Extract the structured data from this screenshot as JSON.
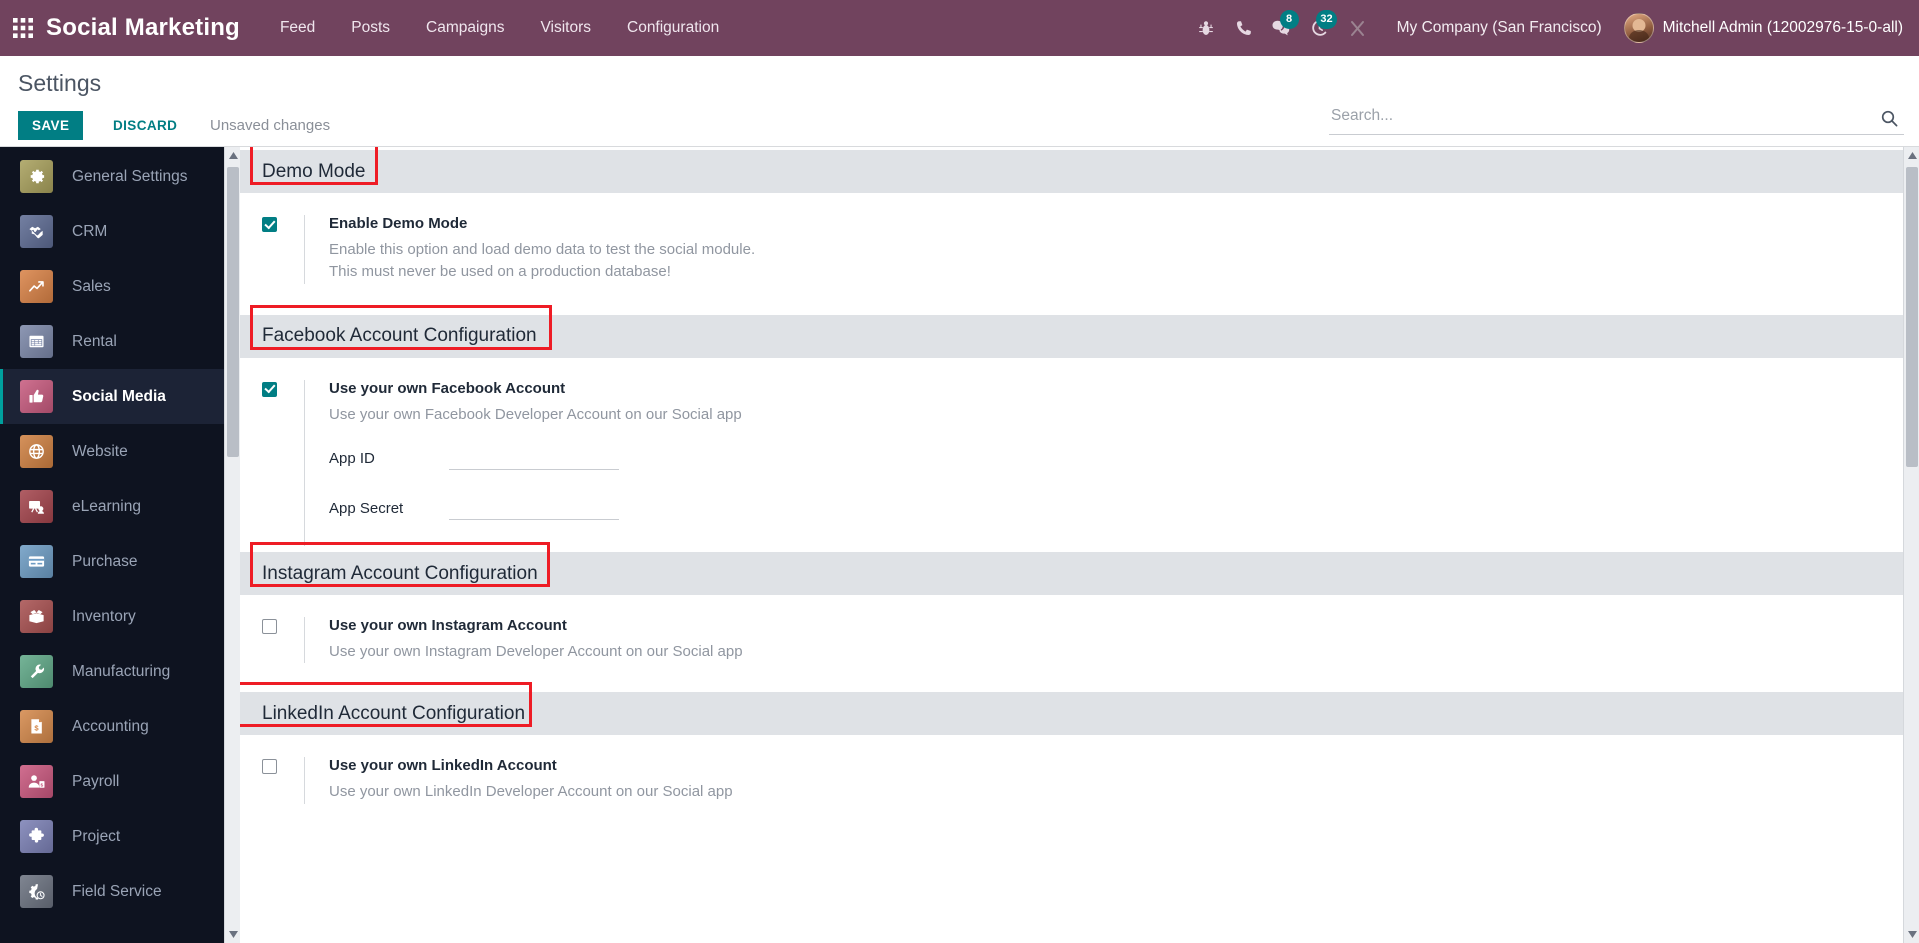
{
  "navbar": {
    "apps_icon": "apps-grid-icon",
    "brand": "Social Marketing",
    "menu": [
      {
        "label": "Feed"
      },
      {
        "label": "Posts"
      },
      {
        "label": "Campaigns"
      },
      {
        "label": "Visitors"
      },
      {
        "label": "Configuration"
      }
    ],
    "icons": [
      {
        "name": "bug-icon",
        "badge": ""
      },
      {
        "name": "phone-icon",
        "badge": ""
      },
      {
        "name": "messages-icon",
        "badge": "8"
      },
      {
        "name": "activities-clock-icon",
        "badge": "32"
      },
      {
        "name": "shortcuts-icon",
        "badge": ""
      }
    ],
    "company": "My Company (San Francisco)",
    "user": "Mitchell Admin (12002976-15-0-all)",
    "background_color": "#71435e",
    "badge_color": "#017e84"
  },
  "control_panel": {
    "title": "Settings",
    "save_label": "SAVE",
    "discard_label": "DISCARD",
    "unsaved_label": "Unsaved changes",
    "save_color": "#017e84"
  },
  "search": {
    "placeholder": "Search...",
    "value": "",
    "icon": "magnifier-icon"
  },
  "sidebar": {
    "active": "Social Media",
    "items": [
      {
        "label": "General Settings",
        "icon": "gear-icon",
        "color": "#a8a05c",
        "active": false
      },
      {
        "label": "CRM",
        "icon": "handshake-icon",
        "color": "#5d6b93",
        "active": false
      },
      {
        "label": "Sales",
        "icon": "chart-up-icon",
        "color": "#d98246",
        "active": false
      },
      {
        "label": "Rental",
        "icon": "calendar-icon",
        "color": "#7b87a8",
        "active": false
      },
      {
        "label": "Social Media",
        "icon": "thumbs-up-icon",
        "color": "#c75a7e",
        "active": true
      },
      {
        "label": "Website",
        "icon": "globe-icon",
        "color": "#cf8041",
        "active": false
      },
      {
        "label": "eLearning",
        "icon": "presentation-icon",
        "color": "#a4444c",
        "active": false
      },
      {
        "label": "Purchase",
        "icon": "card-icon",
        "color": "#6d9cc4",
        "active": false
      },
      {
        "label": "Inventory",
        "icon": "box-icon",
        "color": "#a85050",
        "active": false
      },
      {
        "label": "Manufacturing",
        "icon": "wrench-icon",
        "color": "#5fa887",
        "active": false
      },
      {
        "label": "Accounting",
        "icon": "invoice-icon",
        "color": "#d4884a",
        "active": false
      },
      {
        "label": "Payroll",
        "icon": "person-money-icon",
        "color": "#c9577e",
        "active": false
      },
      {
        "label": "Project",
        "icon": "puzzle-icon",
        "color": "#7b80b5",
        "active": false
      },
      {
        "label": "Field Service",
        "icon": "gear-clock-icon",
        "color": "#6b7280",
        "active": false
      }
    ]
  },
  "settings": {
    "annotation_color": "#ee1c25",
    "sections": [
      {
        "title": "Demo Mode",
        "annotated": true,
        "annot_width": 128,
        "rows": [
          {
            "label": "Enable Demo Mode",
            "checked": true,
            "help_lines": [
              "Enable this option and load demo data to test the social module.",
              "This must never be used on a production database!"
            ],
            "fields": []
          }
        ]
      },
      {
        "title": "Facebook Account Configuration",
        "annotated": true,
        "annot_width": 302,
        "rows": [
          {
            "label": "Use your own Facebook Account",
            "checked": true,
            "help_lines": [
              "Use your own Facebook Developer Account on our Social app"
            ],
            "fields": [
              {
                "label": "App ID",
                "value": ""
              },
              {
                "label": "App Secret",
                "value": ""
              }
            ]
          }
        ]
      },
      {
        "title": "Instagram Account Configuration",
        "annotated": true,
        "annot_width": 300,
        "rows": [
          {
            "label": "Use your own Instagram Account",
            "checked": false,
            "help_lines": [
              "Use your own Instagram Developer Account on our Social app"
            ],
            "fields": []
          }
        ]
      },
      {
        "title": "LinkedIn Account Configuration",
        "annotated": true,
        "annot_width": 292,
        "rows": [
          {
            "label": "Use your own LinkedIn Account",
            "checked": false,
            "help_lines": [
              "Use your own LinkedIn Developer Account on our Social app"
            ],
            "fields": []
          }
        ]
      }
    ]
  }
}
